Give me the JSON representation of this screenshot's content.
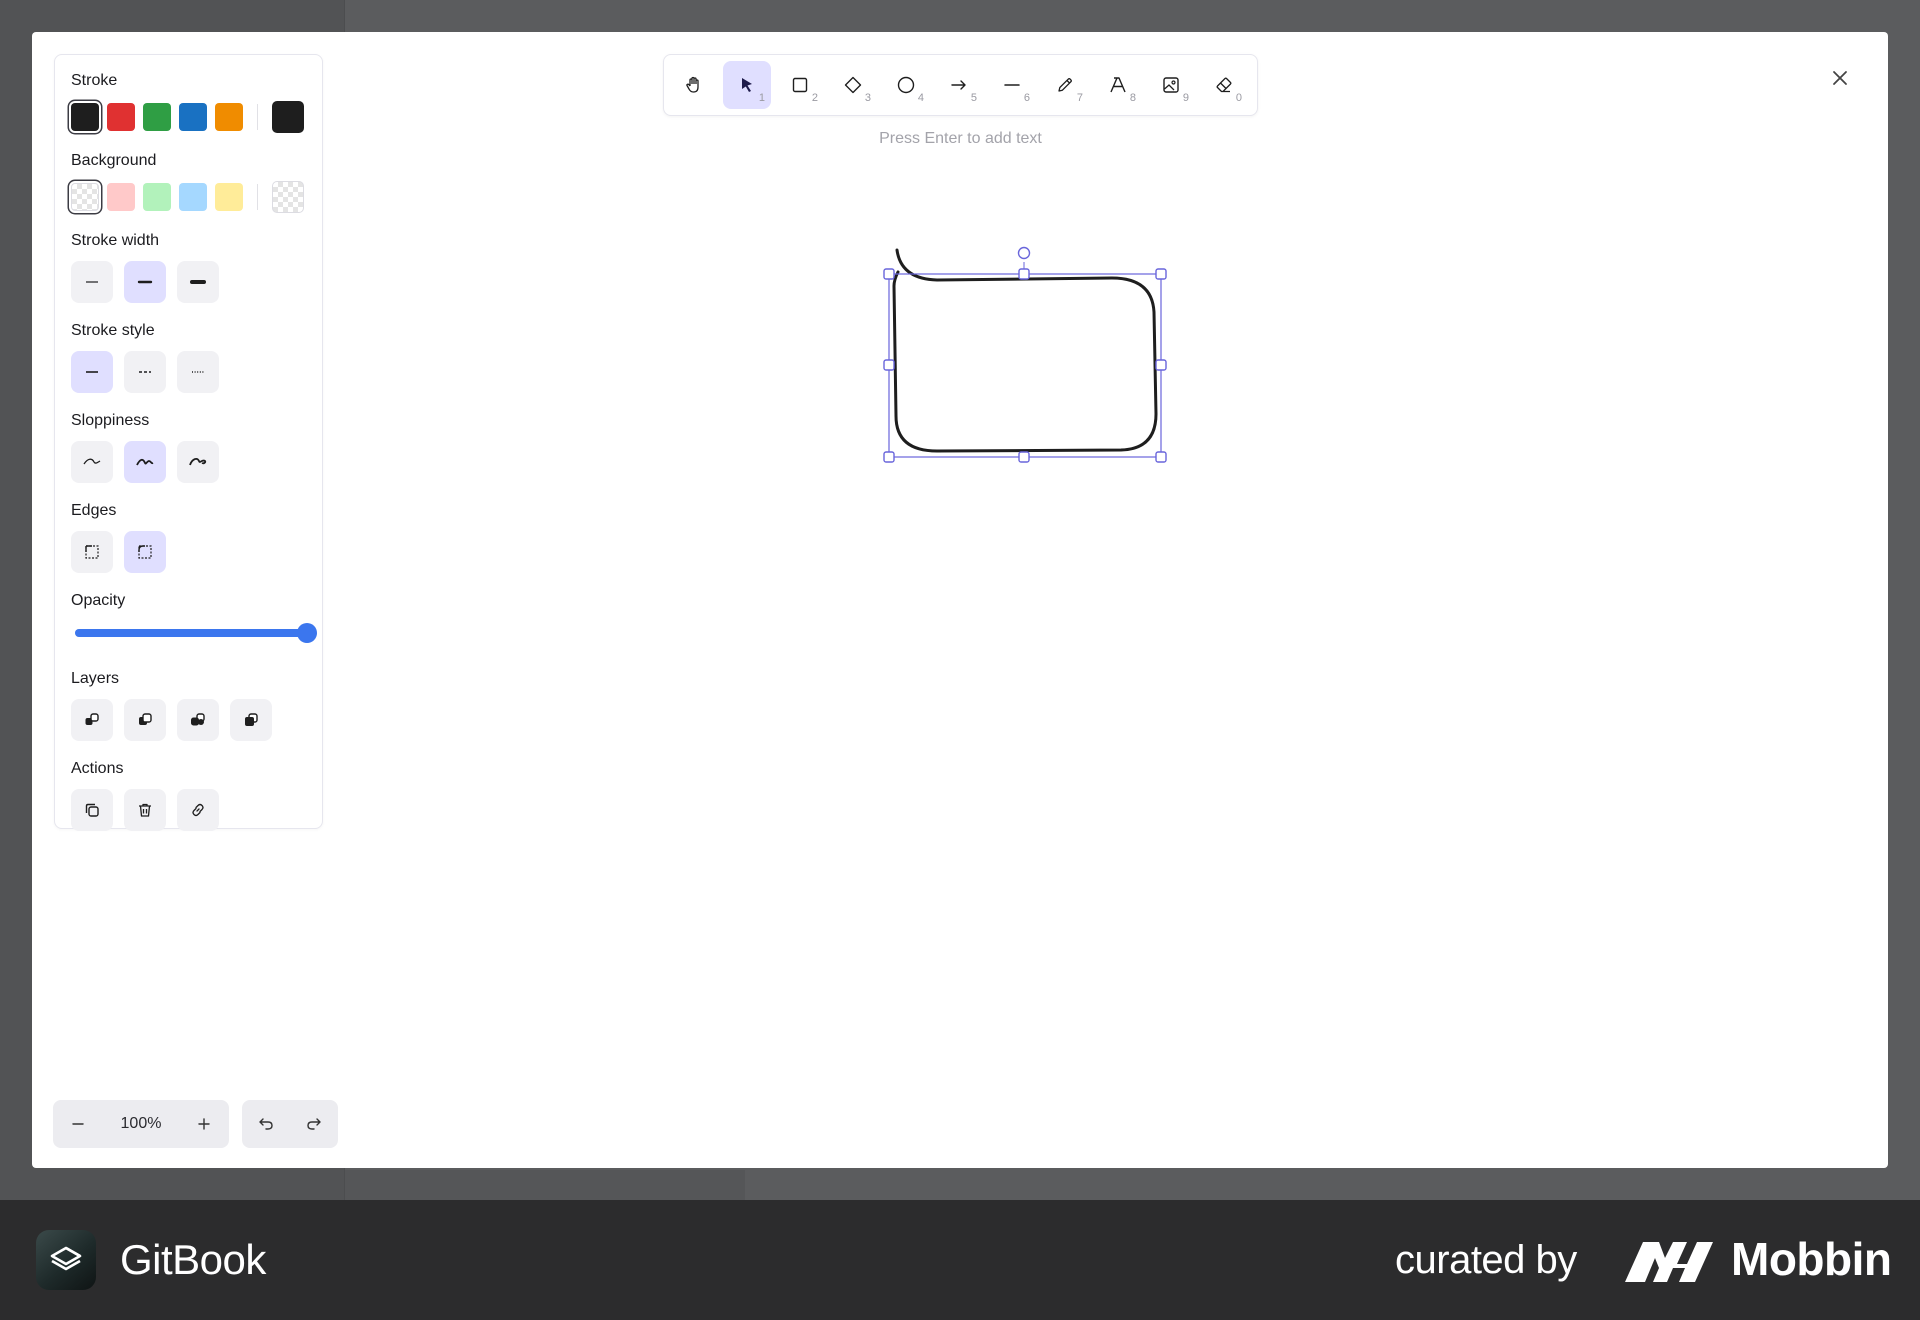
{
  "background_app": {},
  "modal": {
    "close_label": "×"
  },
  "properties": {
    "stroke": {
      "title": "Stroke",
      "colors": [
        "#1e1e1e",
        "#e03131",
        "#2f9e44",
        "#1971c2",
        "#f08c00"
      ],
      "selected": "#1e1e1e",
      "current": "#1e1e1e"
    },
    "background": {
      "title": "Background",
      "colors": [
        "transparent",
        "#ffc9c9",
        "#b2f2bb",
        "#a5d8ff",
        "#ffec99"
      ],
      "selected": "transparent",
      "current": "transparent"
    },
    "stroke_width": {
      "title": "Stroke width",
      "options": [
        "thin",
        "bold",
        "extra-bold"
      ],
      "selected": "bold"
    },
    "stroke_style": {
      "title": "Stroke style",
      "options": [
        "solid",
        "dashed",
        "dotted"
      ],
      "selected": "solid"
    },
    "sloppiness": {
      "title": "Sloppiness",
      "options": [
        "architect",
        "artist",
        "cartoonist"
      ],
      "selected": "artist"
    },
    "edges": {
      "title": "Edges",
      "options": [
        "sharp",
        "round"
      ],
      "selected": "round"
    },
    "opacity": {
      "title": "Opacity",
      "value": 100
    },
    "layers": {
      "title": "Layers",
      "options": [
        "send-to-back-icon",
        "send-backward-icon",
        "bring-forward-icon",
        "bring-to-front-icon"
      ]
    },
    "actions": {
      "title": "Actions",
      "options": [
        "duplicate-icon",
        "trash-icon",
        "link-icon"
      ]
    }
  },
  "toolbar": {
    "tools": [
      {
        "name": "hand",
        "icon": "hand-icon",
        "key": ""
      },
      {
        "name": "selection",
        "icon": "pointer-icon",
        "key": "1"
      },
      {
        "name": "rectangle",
        "icon": "rectangle-icon",
        "key": "2"
      },
      {
        "name": "diamond",
        "icon": "diamond-icon",
        "key": "3"
      },
      {
        "name": "ellipse",
        "icon": "ellipse-icon",
        "key": "4"
      },
      {
        "name": "arrow",
        "icon": "arrow-icon",
        "key": "5"
      },
      {
        "name": "line",
        "icon": "line-icon",
        "key": "6"
      },
      {
        "name": "draw",
        "icon": "pencil-icon",
        "key": "7"
      },
      {
        "name": "text",
        "icon": "text-icon",
        "key": "8"
      },
      {
        "name": "image",
        "icon": "image-icon",
        "key": "9"
      },
      {
        "name": "eraser",
        "icon": "eraser-icon",
        "key": "0"
      }
    ],
    "active": "selection",
    "hint": "Press Enter to add text"
  },
  "zoom": {
    "level": "100%",
    "minus": "−",
    "plus": "+"
  },
  "footer": {
    "brand": "GitBook",
    "curated": "curated by",
    "mobbin": "Mobbin"
  }
}
